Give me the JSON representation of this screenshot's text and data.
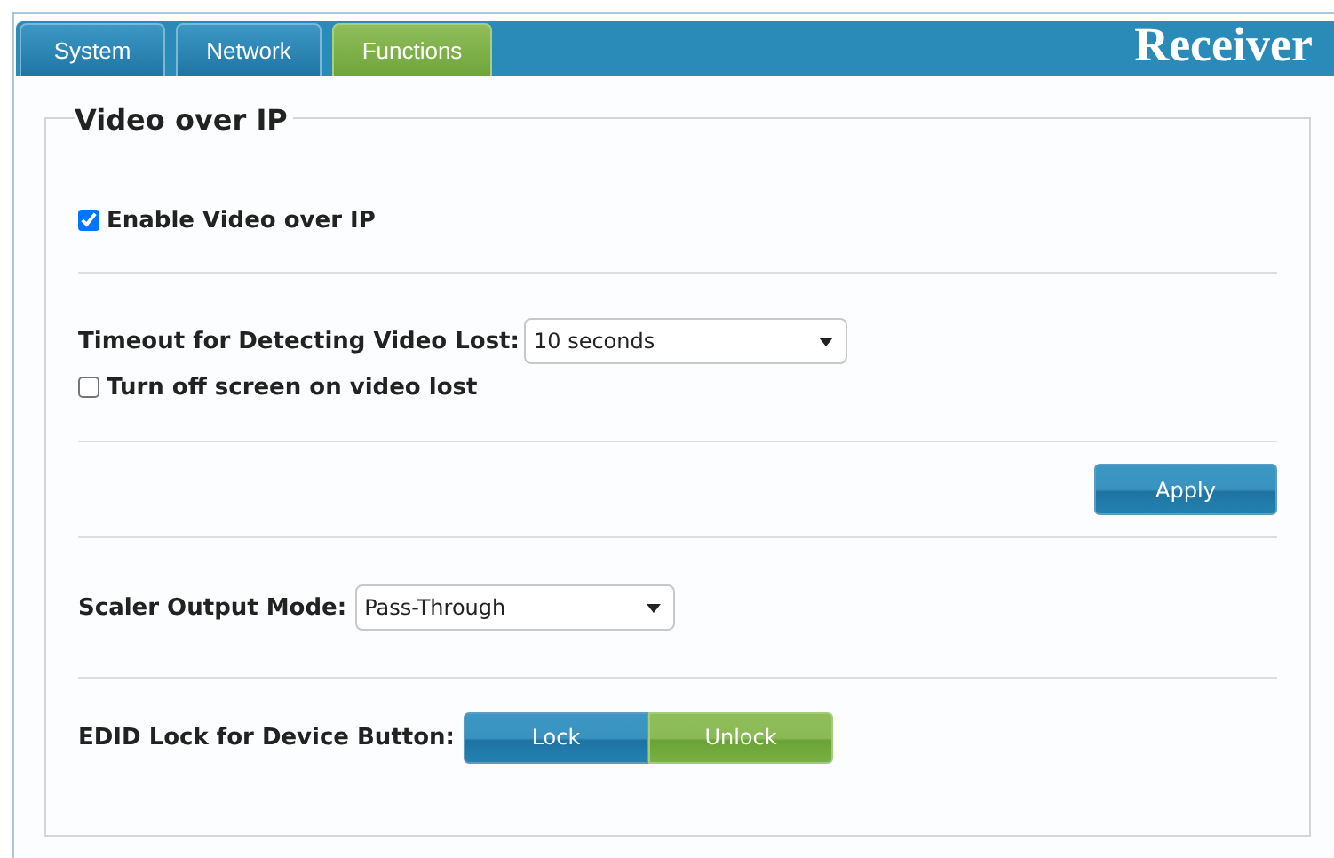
{
  "tabs": [
    {
      "label": "System",
      "selected": false
    },
    {
      "label": "Network",
      "selected": false
    },
    {
      "label": "Functions",
      "selected": true
    }
  ],
  "header_title": "Receiver",
  "section": {
    "title": "Video over IP",
    "enable": {
      "label": "Enable Video over IP",
      "checked": true
    },
    "timeout": {
      "label": "Timeout for Detecting Video Lost:",
      "value": "10 seconds"
    },
    "turn_off": {
      "label": "Turn off screen on video lost",
      "checked": false
    },
    "apply_button": "Apply",
    "scaler": {
      "label": "Scaler Output Mode:",
      "value": "Pass-Through"
    },
    "edid": {
      "label": "EDID Lock for Device Button:",
      "buttons": [
        {
          "label": "Lock",
          "selected": false
        },
        {
          "label": "Unlock",
          "selected": true
        }
      ]
    }
  }
}
